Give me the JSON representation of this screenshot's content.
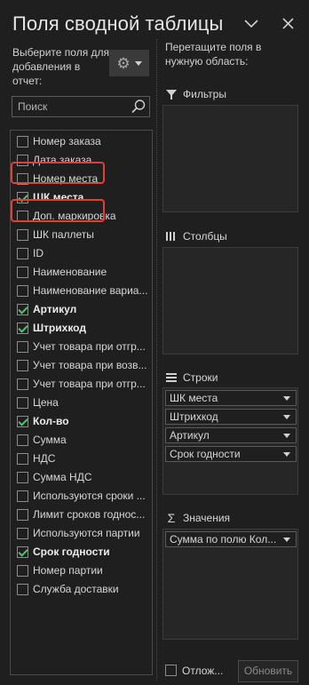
{
  "panel": {
    "title": "Поля сводной таблицы",
    "left_hint": "Выберите поля для добавления в отчет:",
    "right_hint": "Перетащите поля в нужную область:",
    "search_placeholder": "Поиск"
  },
  "fields": [
    {
      "label": "Номер заказа",
      "checked": false,
      "bold": false
    },
    {
      "label": "Дата заказа",
      "checked": false,
      "bold": false
    },
    {
      "label": "Номер места",
      "checked": false,
      "bold": false
    },
    {
      "label": "ШК места",
      "checked": true,
      "bold": true
    },
    {
      "label": "Доп. маркировка",
      "checked": false,
      "bold": false
    },
    {
      "label": "ШК паллеты",
      "checked": false,
      "bold": false
    },
    {
      "label": "ID",
      "checked": false,
      "bold": false
    },
    {
      "label": "Наименование",
      "checked": false,
      "bold": false
    },
    {
      "label": "Наименование вариа...",
      "checked": false,
      "bold": false
    },
    {
      "label": "Артикул",
      "checked": true,
      "bold": true
    },
    {
      "label": "Штрихкод",
      "checked": true,
      "bold": true
    },
    {
      "label": "Учет товара при отгр...",
      "checked": false,
      "bold": false
    },
    {
      "label": "Учет товара при возв...",
      "checked": false,
      "bold": false
    },
    {
      "label": "Учет товара при отгр...",
      "checked": false,
      "bold": false
    },
    {
      "label": "Цена",
      "checked": false,
      "bold": false
    },
    {
      "label": "Кол-во",
      "checked": true,
      "bold": true
    },
    {
      "label": "Сумма",
      "checked": false,
      "bold": false
    },
    {
      "label": "НДС",
      "checked": false,
      "bold": false
    },
    {
      "label": "Сумма НДС",
      "checked": false,
      "bold": false
    },
    {
      "label": "Используются сроки ...",
      "checked": false,
      "bold": false
    },
    {
      "label": "Лимит сроков годнос...",
      "checked": false,
      "bold": false
    },
    {
      "label": "Используются партии",
      "checked": false,
      "bold": false
    },
    {
      "label": "Срок годности",
      "checked": true,
      "bold": true
    },
    {
      "label": "Номер партии",
      "checked": false,
      "bold": false
    },
    {
      "label": "Служба доставки",
      "checked": false,
      "bold": false
    }
  ],
  "highlighted_fields": [
    "ШК места",
    "ШК паллеты"
  ],
  "areas": {
    "filters": {
      "label": "Фильтры",
      "items": []
    },
    "columns": {
      "label": "Столбцы",
      "items": []
    },
    "rows": {
      "label": "Строки",
      "items": [
        "ШК места",
        "Штрихкод",
        "Артикул",
        "Срок годности"
      ]
    },
    "values": {
      "label": "Значения",
      "items": [
        "Сумма по полю Кол..."
      ]
    }
  },
  "footer": {
    "defer_label": "Отлож...",
    "defer_checked": false,
    "update_label": "Обновить"
  },
  "colors": {
    "background": "#1f1f1f",
    "checkmark": "#4ec36b",
    "highlight": "#e0403a"
  }
}
